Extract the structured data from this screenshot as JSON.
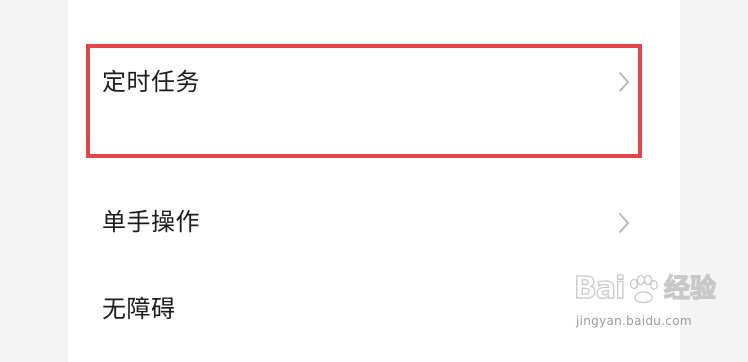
{
  "settings": {
    "items": [
      {
        "label": "定时任务",
        "icon": "chevron-right-icon",
        "highlighted": true
      },
      {
        "label": "单手操作",
        "icon": "chevron-right-icon"
      },
      {
        "label": "无障碍"
      }
    ]
  },
  "highlight": {
    "color": "#e4454a"
  },
  "watermark": {
    "logo": "Bai",
    "brand": "经验",
    "url": "jingyan.baidu.com",
    "icon": "paw-icon"
  }
}
